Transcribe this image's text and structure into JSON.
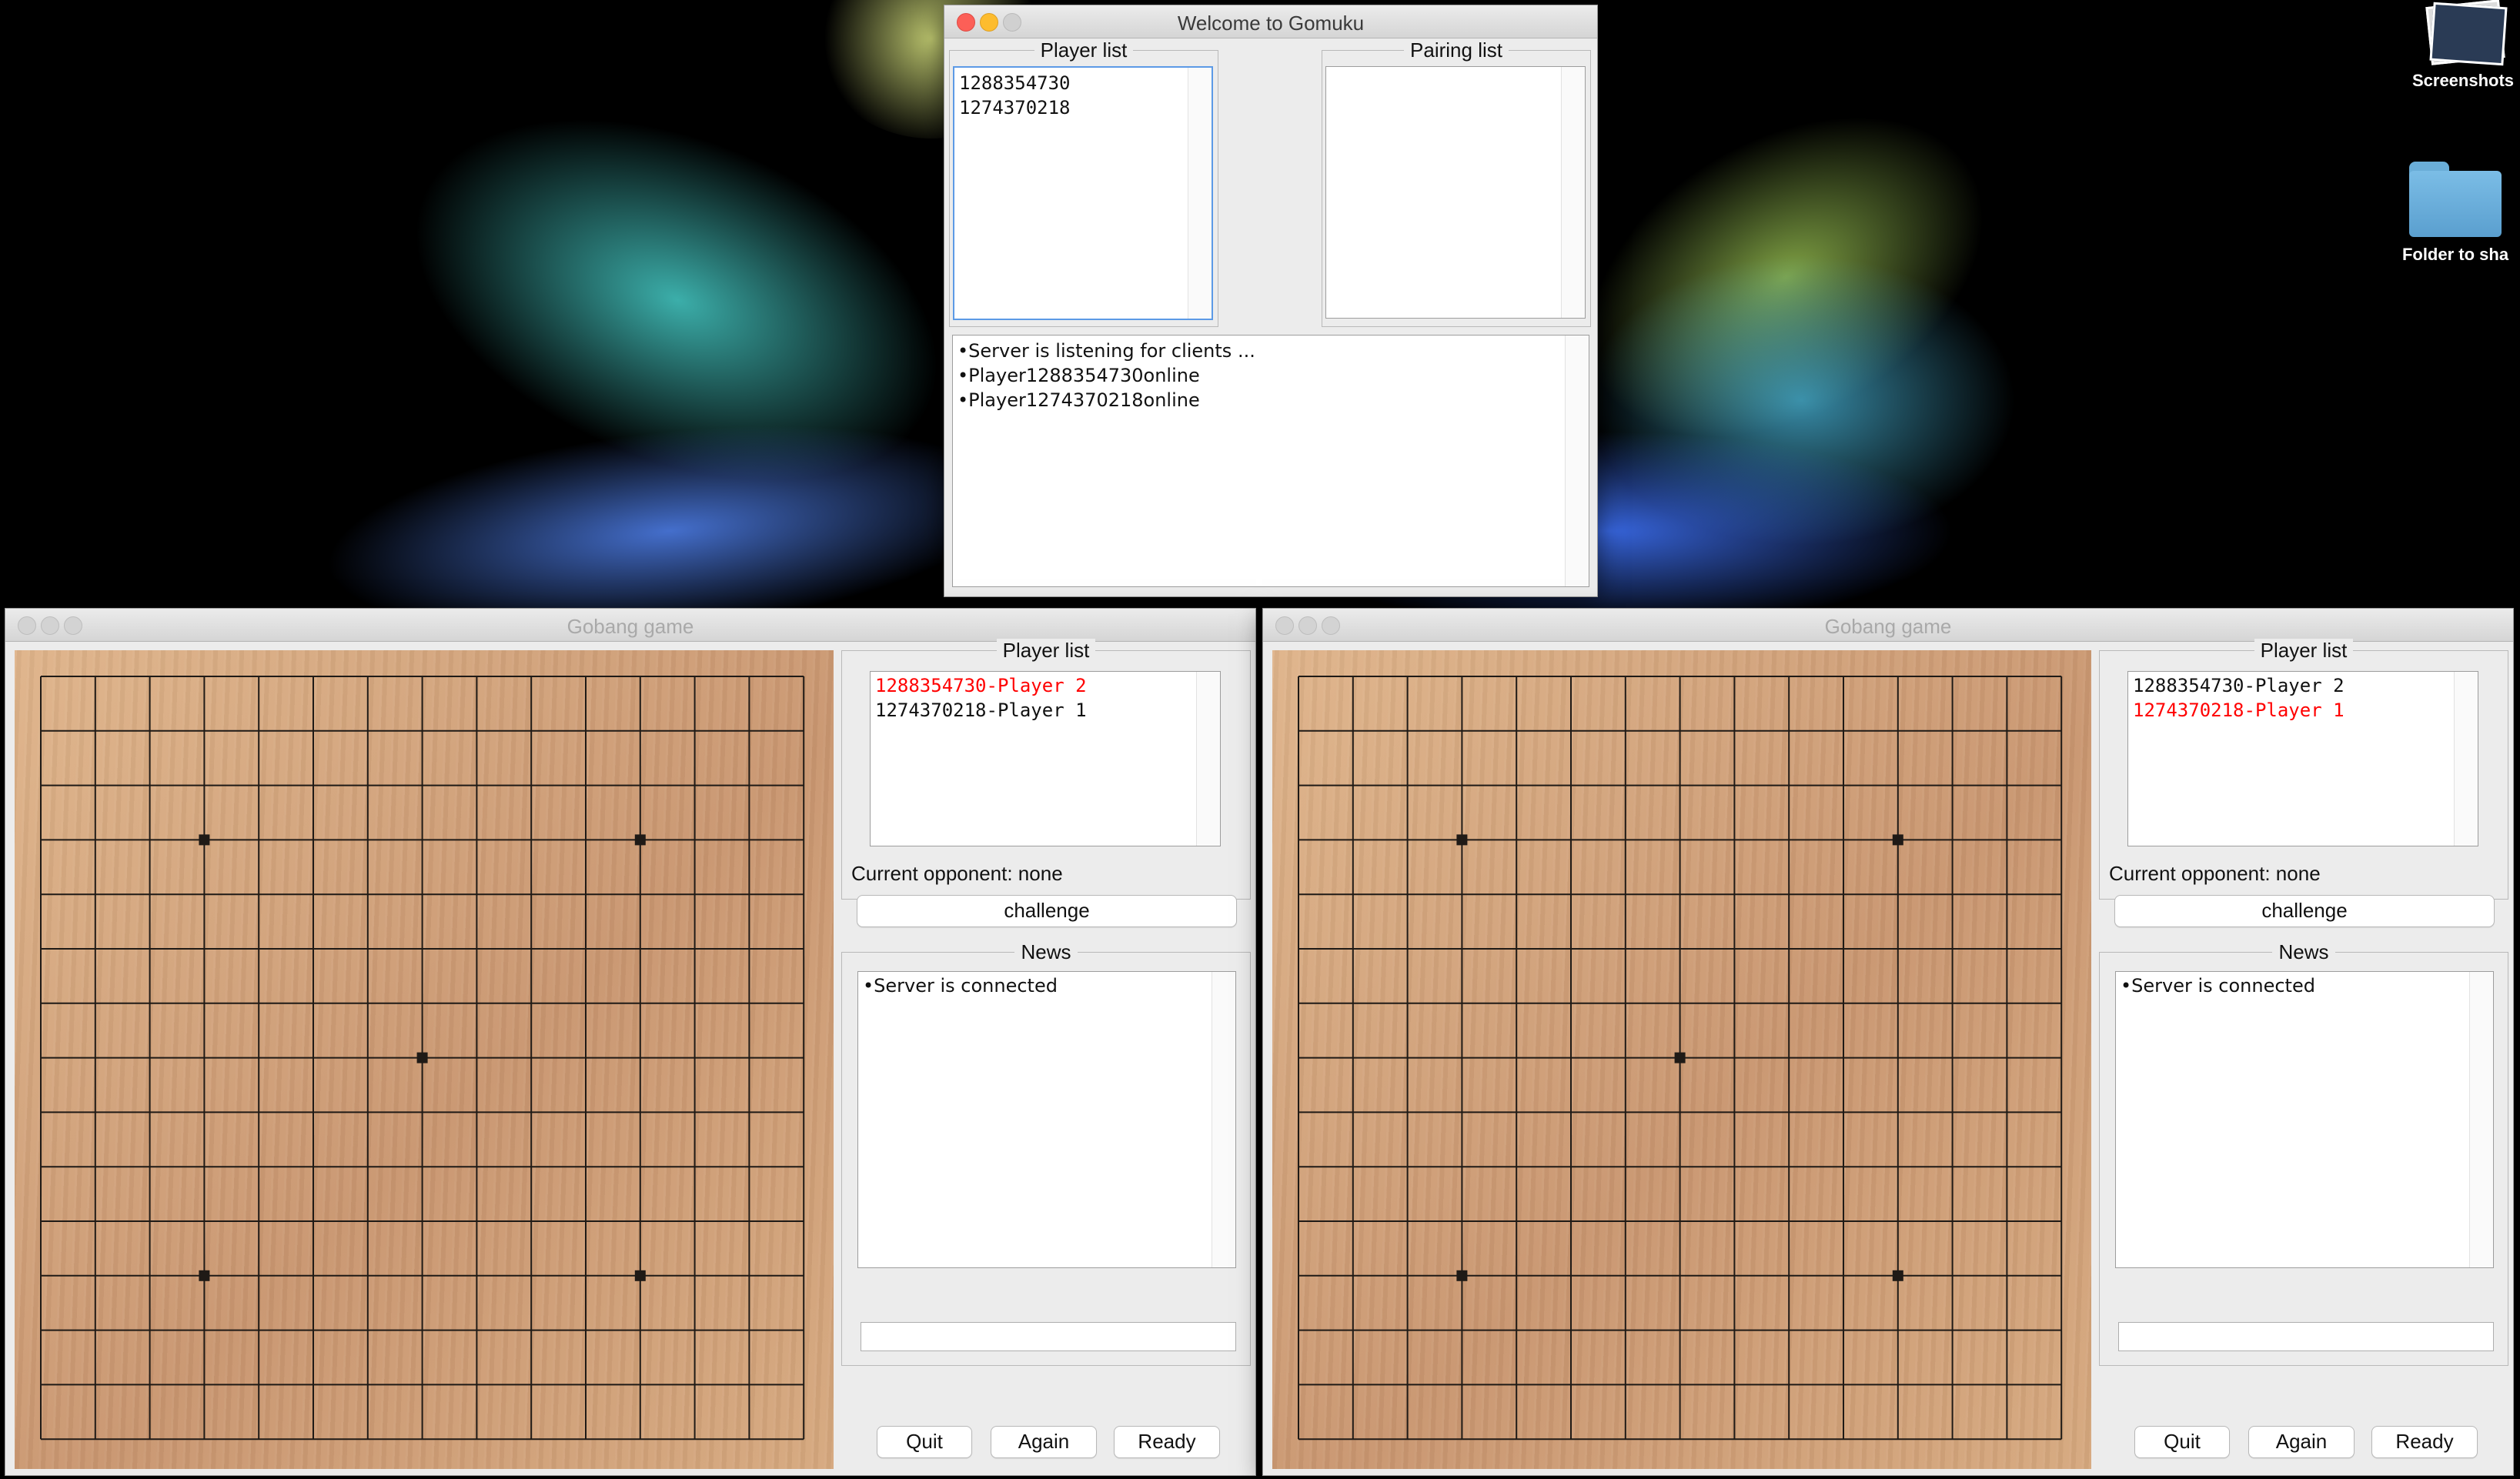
{
  "desktop": {
    "icons": [
      {
        "label": "Screenshots",
        "icon": "screenshots-stack-icon"
      },
      {
        "label": "Folder to sha",
        "icon": "folder-icon"
      }
    ]
  },
  "server_window": {
    "title": "Welcome to Gomuku",
    "player_list": {
      "title": "Player list",
      "items": [
        "1288354730",
        "1274370218"
      ]
    },
    "pairing_list": {
      "title": "Pairing list",
      "items": []
    },
    "log": [
      "•Server is listening for clients  ...",
      "•Player1288354730online",
      "•Player1274370218online"
    ]
  },
  "game_windows": [
    {
      "title": "Gobang game",
      "board": {
        "lines": 15,
        "star_points": [
          [
            3,
            3
          ],
          [
            3,
            11
          ],
          [
            7,
            7
          ],
          [
            11,
            3
          ],
          [
            11,
            11
          ]
        ],
        "stones": []
      },
      "player_list": {
        "title": "Player list",
        "items": [
          {
            "text": "1288354730-Player 2",
            "highlight": true
          },
          {
            "text": "1274370218-Player 1",
            "highlight": false
          }
        ]
      },
      "current_opponent": "Current opponent: none",
      "challenge_label": "challenge",
      "news": {
        "title": "News",
        "items": [
          "•Server is connected"
        ]
      },
      "chat_input": "",
      "buttons": {
        "quit": "Quit",
        "again": "Again",
        "ready": "Ready"
      }
    },
    {
      "title": "Gobang game",
      "board": {
        "lines": 15,
        "star_points": [
          [
            3,
            3
          ],
          [
            3,
            11
          ],
          [
            7,
            7
          ],
          [
            11,
            3
          ],
          [
            11,
            11
          ]
        ],
        "stones": []
      },
      "player_list": {
        "title": "Player list",
        "items": [
          {
            "text": "1288354730-Player 2",
            "highlight": false
          },
          {
            "text": "1274370218-Player 1",
            "highlight": true
          }
        ]
      },
      "current_opponent": "Current opponent: none",
      "challenge_label": "challenge",
      "news": {
        "title": "News",
        "items": [
          "•Server is connected"
        ]
      },
      "chat_input": "",
      "buttons": {
        "quit": "Quit",
        "again": "Again",
        "ready": "Ready"
      }
    }
  ],
  "colors": {
    "highlight_text": "#ff0000",
    "board_line": "#1f1a16",
    "focus_ring": "#5c9ae6"
  }
}
